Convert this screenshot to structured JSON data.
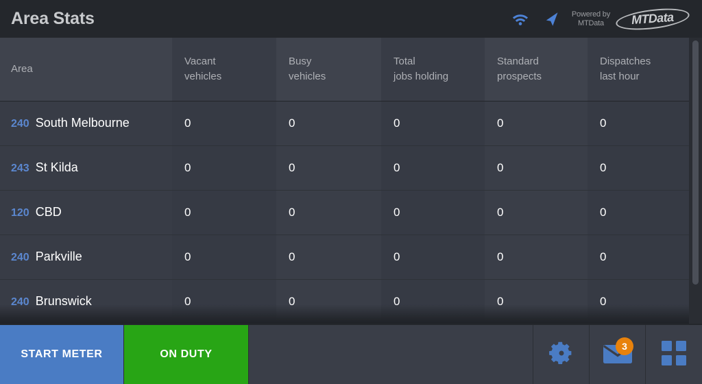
{
  "header": {
    "title": "Area Stats",
    "wifi_icon": "wifi-icon",
    "navigation_icon": "navigation-arrow-icon",
    "powered_by_line1": "Powered by",
    "powered_by_line2": "MTData",
    "logo_text": "MTData"
  },
  "table": {
    "columns": [
      {
        "label": "Area",
        "line1": "Area",
        "line2": ""
      },
      {
        "label": "Vacant vehicles",
        "line1": "Vacant",
        "line2": "vehicles"
      },
      {
        "label": "Busy vehicles",
        "line1": "Busy",
        "line2": "vehicles"
      },
      {
        "label": "Total jobs holding",
        "line1": "Total",
        "line2": "jobs holding"
      },
      {
        "label": "Standard prospects",
        "line1": "Standard",
        "line2": "prospects"
      },
      {
        "label": "Dispatches last hour",
        "line1": "Dispatches",
        "line2": "last hour"
      }
    ],
    "rows": [
      {
        "code": "240",
        "name": "South Melbourne",
        "vacant_vehicles": "0",
        "busy_vehicles": "0",
        "total_jobs_holding": "0",
        "standard_prospects": "0",
        "dispatches_last_hour": "0"
      },
      {
        "code": "243",
        "name": "St Kilda",
        "vacant_vehicles": "0",
        "busy_vehicles": "0",
        "total_jobs_holding": "0",
        "standard_prospects": "0",
        "dispatches_last_hour": "0"
      },
      {
        "code": "120",
        "name": "CBD",
        "vacant_vehicles": "0",
        "busy_vehicles": "0",
        "total_jobs_holding": "0",
        "standard_prospects": "0",
        "dispatches_last_hour": "0"
      },
      {
        "code": "240",
        "name": "Parkville",
        "vacant_vehicles": "0",
        "busy_vehicles": "0",
        "total_jobs_holding": "0",
        "standard_prospects": "0",
        "dispatches_last_hour": "0"
      },
      {
        "code": "240",
        "name": "Brunswick",
        "vacant_vehicles": "0",
        "busy_vehicles": "0",
        "total_jobs_holding": "0",
        "standard_prospects": "0",
        "dispatches_last_hour": "0"
      }
    ]
  },
  "bottom_bar": {
    "start_meter_label": "START METER",
    "on_duty_label": "ON DUTY",
    "settings_icon": "gear-icon",
    "messages_icon": "envelope-icon",
    "messages_badge": "3",
    "apps_icon": "grid-apps-icon"
  },
  "colors": {
    "accent_blue": "#5b87cf",
    "button_blue": "#4a7cc4",
    "button_green": "#28a515",
    "badge_orange": "#e8820c",
    "header_bg": "#24272c",
    "table_bg": "#3a3e48",
    "text_primary": "#ffffff",
    "text_muted": "#aeb0b5"
  }
}
